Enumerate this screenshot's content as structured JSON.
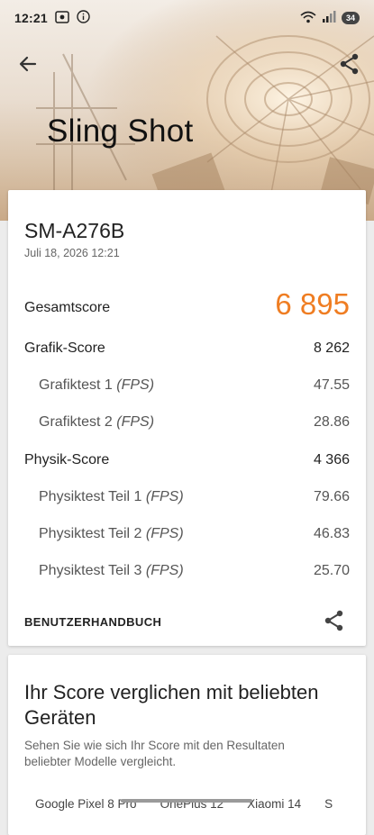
{
  "status": {
    "time": "12:21",
    "battery": "34"
  },
  "header": {
    "title": "Sling Shot"
  },
  "result": {
    "device": "SM-A276B",
    "datetime": "Juli 18, 2026 12:21",
    "total_label": "Gesamtscore",
    "total_value": "6 895",
    "graphics_label": "Grafik-Score",
    "graphics_value": "8 262",
    "graphics_tests": [
      {
        "name": "Grafiktest 1",
        "unit": "(FPS)",
        "value": "47.55"
      },
      {
        "name": "Grafiktest 2",
        "unit": "(FPS)",
        "value": "28.86"
      }
    ],
    "physics_label": "Physik-Score",
    "physics_value": "4 366",
    "physics_tests": [
      {
        "name": "Physiktest Teil 1",
        "unit": "(FPS)",
        "value": "79.66"
      },
      {
        "name": "Physiktest Teil 2",
        "unit": "(FPS)",
        "value": "46.83"
      },
      {
        "name": "Physiktest Teil 3",
        "unit": "(FPS)",
        "value": "25.70"
      }
    ],
    "manual_label": "BENUTZERHANDBUCH"
  },
  "compare": {
    "title": "Ihr Score verglichen mit beliebten Geräten",
    "description": "Sehen Sie wie sich Ihr Score mit den Resultaten beliebter Modelle vergleicht.",
    "tabs": [
      "Google Pixel 8 Pro",
      "OnePlus 12",
      "Xiaomi 14",
      "S"
    ]
  },
  "colors": {
    "accent": "#ef7d22",
    "background": "#ececec",
    "card": "#ffffff"
  }
}
